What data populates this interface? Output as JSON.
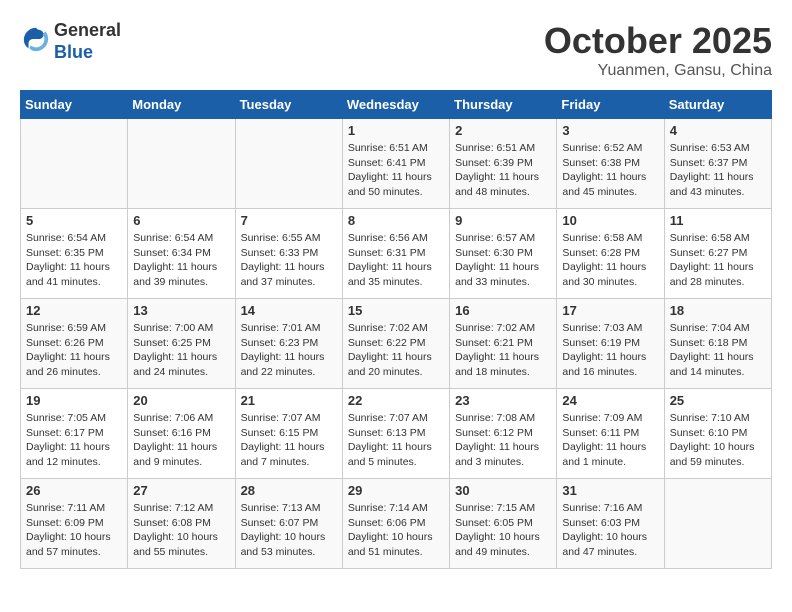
{
  "header": {
    "logo_general": "General",
    "logo_blue": "Blue",
    "month_title": "October 2025",
    "location": "Yuanmen, Gansu, China"
  },
  "weekdays": [
    "Sunday",
    "Monday",
    "Tuesday",
    "Wednesday",
    "Thursday",
    "Friday",
    "Saturday"
  ],
  "weeks": [
    [
      {
        "day": "",
        "info": ""
      },
      {
        "day": "",
        "info": ""
      },
      {
        "day": "",
        "info": ""
      },
      {
        "day": "1",
        "info": "Sunrise: 6:51 AM\nSunset: 6:41 PM\nDaylight: 11 hours\nand 50 minutes."
      },
      {
        "day": "2",
        "info": "Sunrise: 6:51 AM\nSunset: 6:39 PM\nDaylight: 11 hours\nand 48 minutes."
      },
      {
        "day": "3",
        "info": "Sunrise: 6:52 AM\nSunset: 6:38 PM\nDaylight: 11 hours\nand 45 minutes."
      },
      {
        "day": "4",
        "info": "Sunrise: 6:53 AM\nSunset: 6:37 PM\nDaylight: 11 hours\nand 43 minutes."
      }
    ],
    [
      {
        "day": "5",
        "info": "Sunrise: 6:54 AM\nSunset: 6:35 PM\nDaylight: 11 hours\nand 41 minutes."
      },
      {
        "day": "6",
        "info": "Sunrise: 6:54 AM\nSunset: 6:34 PM\nDaylight: 11 hours\nand 39 minutes."
      },
      {
        "day": "7",
        "info": "Sunrise: 6:55 AM\nSunset: 6:33 PM\nDaylight: 11 hours\nand 37 minutes."
      },
      {
        "day": "8",
        "info": "Sunrise: 6:56 AM\nSunset: 6:31 PM\nDaylight: 11 hours\nand 35 minutes."
      },
      {
        "day": "9",
        "info": "Sunrise: 6:57 AM\nSunset: 6:30 PM\nDaylight: 11 hours\nand 33 minutes."
      },
      {
        "day": "10",
        "info": "Sunrise: 6:58 AM\nSunset: 6:28 PM\nDaylight: 11 hours\nand 30 minutes."
      },
      {
        "day": "11",
        "info": "Sunrise: 6:58 AM\nSunset: 6:27 PM\nDaylight: 11 hours\nand 28 minutes."
      }
    ],
    [
      {
        "day": "12",
        "info": "Sunrise: 6:59 AM\nSunset: 6:26 PM\nDaylight: 11 hours\nand 26 minutes."
      },
      {
        "day": "13",
        "info": "Sunrise: 7:00 AM\nSunset: 6:25 PM\nDaylight: 11 hours\nand 24 minutes."
      },
      {
        "day": "14",
        "info": "Sunrise: 7:01 AM\nSunset: 6:23 PM\nDaylight: 11 hours\nand 22 minutes."
      },
      {
        "day": "15",
        "info": "Sunrise: 7:02 AM\nSunset: 6:22 PM\nDaylight: 11 hours\nand 20 minutes."
      },
      {
        "day": "16",
        "info": "Sunrise: 7:02 AM\nSunset: 6:21 PM\nDaylight: 11 hours\nand 18 minutes."
      },
      {
        "day": "17",
        "info": "Sunrise: 7:03 AM\nSunset: 6:19 PM\nDaylight: 11 hours\nand 16 minutes."
      },
      {
        "day": "18",
        "info": "Sunrise: 7:04 AM\nSunset: 6:18 PM\nDaylight: 11 hours\nand 14 minutes."
      }
    ],
    [
      {
        "day": "19",
        "info": "Sunrise: 7:05 AM\nSunset: 6:17 PM\nDaylight: 11 hours\nand 12 minutes."
      },
      {
        "day": "20",
        "info": "Sunrise: 7:06 AM\nSunset: 6:16 PM\nDaylight: 11 hours\nand 9 minutes."
      },
      {
        "day": "21",
        "info": "Sunrise: 7:07 AM\nSunset: 6:15 PM\nDaylight: 11 hours\nand 7 minutes."
      },
      {
        "day": "22",
        "info": "Sunrise: 7:07 AM\nSunset: 6:13 PM\nDaylight: 11 hours\nand 5 minutes."
      },
      {
        "day": "23",
        "info": "Sunrise: 7:08 AM\nSunset: 6:12 PM\nDaylight: 11 hours\nand 3 minutes."
      },
      {
        "day": "24",
        "info": "Sunrise: 7:09 AM\nSunset: 6:11 PM\nDaylight: 11 hours\nand 1 minute."
      },
      {
        "day": "25",
        "info": "Sunrise: 7:10 AM\nSunset: 6:10 PM\nDaylight: 10 hours\nand 59 minutes."
      }
    ],
    [
      {
        "day": "26",
        "info": "Sunrise: 7:11 AM\nSunset: 6:09 PM\nDaylight: 10 hours\nand 57 minutes."
      },
      {
        "day": "27",
        "info": "Sunrise: 7:12 AM\nSunset: 6:08 PM\nDaylight: 10 hours\nand 55 minutes."
      },
      {
        "day": "28",
        "info": "Sunrise: 7:13 AM\nSunset: 6:07 PM\nDaylight: 10 hours\nand 53 minutes."
      },
      {
        "day": "29",
        "info": "Sunrise: 7:14 AM\nSunset: 6:06 PM\nDaylight: 10 hours\nand 51 minutes."
      },
      {
        "day": "30",
        "info": "Sunrise: 7:15 AM\nSunset: 6:05 PM\nDaylight: 10 hours\nand 49 minutes."
      },
      {
        "day": "31",
        "info": "Sunrise: 7:16 AM\nSunset: 6:03 PM\nDaylight: 10 hours\nand 47 minutes."
      },
      {
        "day": "",
        "info": ""
      }
    ]
  ]
}
